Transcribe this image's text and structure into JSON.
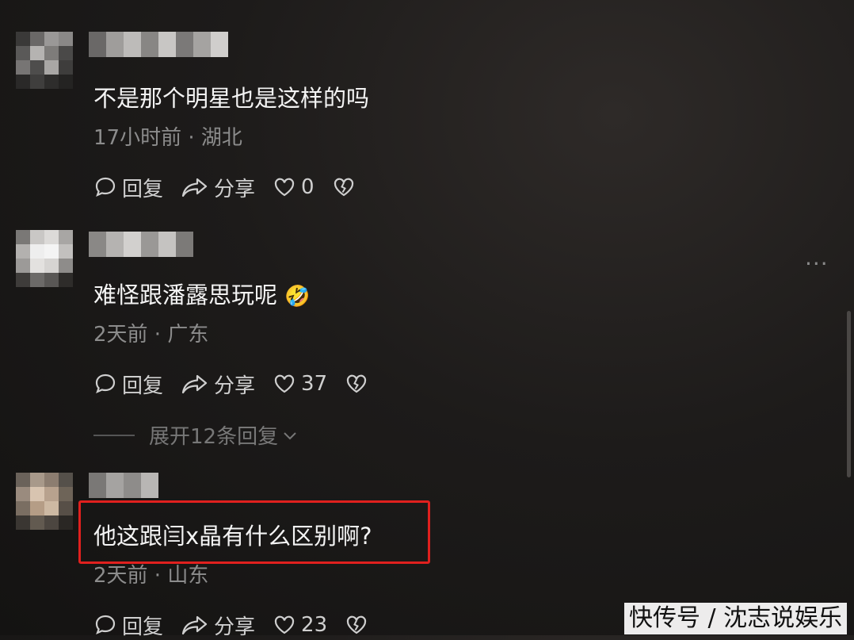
{
  "comments": [
    {
      "text": "不是那个明星也是这样的吗",
      "meta": "17小时前 · 湖北",
      "reply_label": "回复",
      "share_label": "分享",
      "likes": "0"
    },
    {
      "text": "难怪跟潘露思玩呢",
      "emoji": "🤣",
      "meta": "2天前 · 广东",
      "reply_label": "回复",
      "share_label": "分享",
      "likes": "37",
      "expand_label": "展开12条回复"
    },
    {
      "text": "他这跟闫x晶有什么区别啊?",
      "meta": "2天前 · 山东",
      "reply_label": "回复",
      "share_label": "分享",
      "likes": "23"
    }
  ],
  "more_label": "···",
  "watermark": "快传号 / 沈志说娱乐",
  "colors": {
    "background": "#1d1b1a",
    "highlight_border": "#e0201e",
    "meta_text": "#8c8c8c"
  }
}
